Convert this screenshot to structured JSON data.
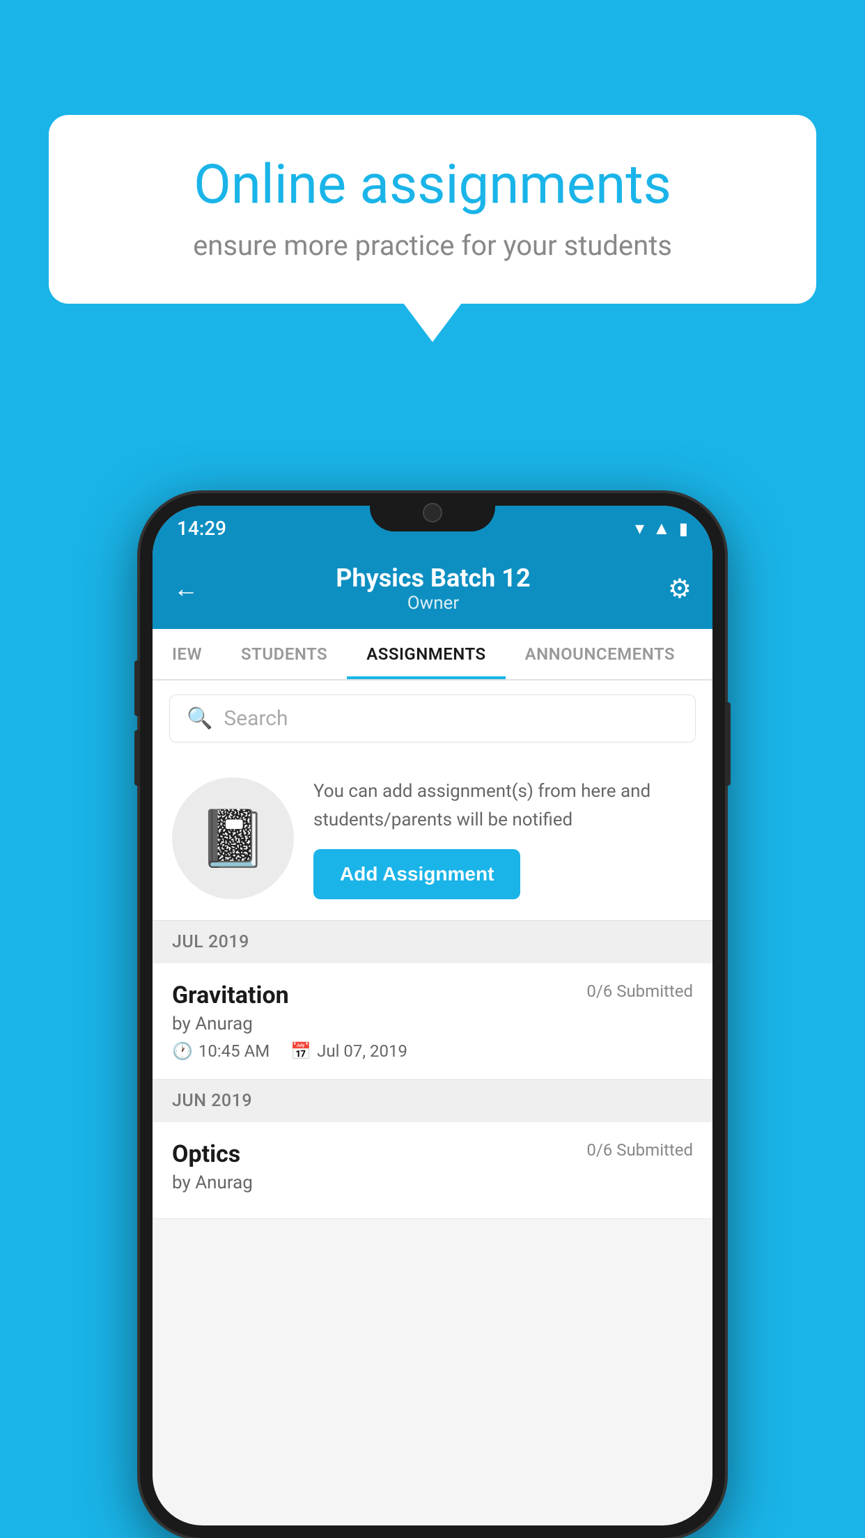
{
  "background_color": "#1ab4e8",
  "bubble": {
    "title": "Online assignments",
    "subtitle": "ensure more practice for your students"
  },
  "phone": {
    "status_bar": {
      "time": "14:29"
    },
    "header": {
      "title": "Physics Batch 12",
      "subtitle": "Owner",
      "back_icon": "←",
      "settings_icon": "⚙"
    },
    "tabs": [
      {
        "label": "IEW",
        "active": false
      },
      {
        "label": "STUDENTS",
        "active": false
      },
      {
        "label": "ASSIGNMENTS",
        "active": true
      },
      {
        "label": "ANNOUNCEMENTS",
        "active": false
      }
    ],
    "search": {
      "placeholder": "Search"
    },
    "promo": {
      "icon": "📓",
      "text": "You can add assignment(s) from here and students/parents will be notified",
      "button_label": "Add Assignment"
    },
    "sections": [
      {
        "month": "JUL 2019",
        "assignments": [
          {
            "name": "Gravitation",
            "submitted": "0/6 Submitted",
            "by": "by Anurag",
            "time": "10:45 AM",
            "date": "Jul 07, 2019"
          }
        ]
      },
      {
        "month": "JUN 2019",
        "assignments": [
          {
            "name": "Optics",
            "submitted": "0/6 Submitted",
            "by": "by Anurag",
            "time": "",
            "date": ""
          }
        ]
      }
    ]
  }
}
